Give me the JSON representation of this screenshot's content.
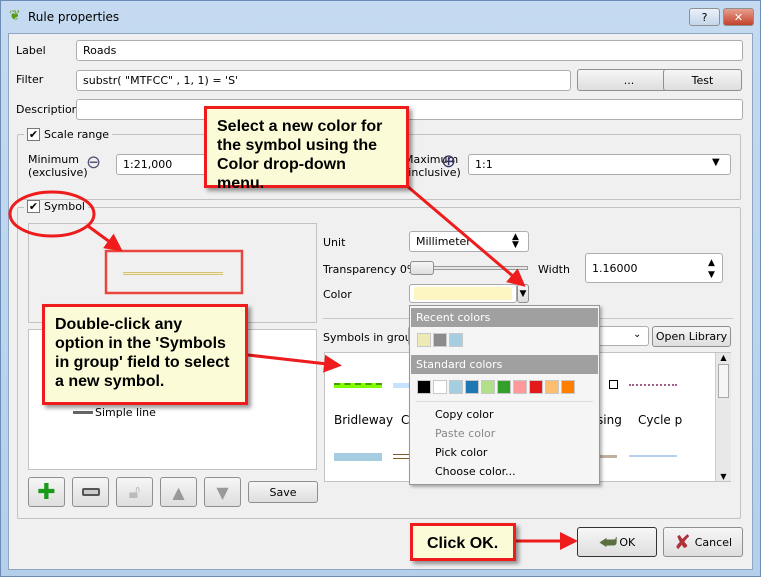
{
  "window": {
    "title": "Rule properties",
    "help": "?",
    "close": "✕"
  },
  "label": {
    "label": "Label",
    "value": "Roads"
  },
  "filter": {
    "label": "Filter",
    "value": "substr(  \"MTFCC\" , 1, 1) = 'S'",
    "ellipsis": "...",
    "test": "Test"
  },
  "description": {
    "label": "Description",
    "value": ""
  },
  "scale": {
    "title": "Scale range",
    "checked": true,
    "min_label1": "Minimum",
    "min_label2": "(exclusive)",
    "min_value": "1:21,000",
    "max_label1": "Maximum",
    "max_label2": "(inclusive)",
    "max_value": "1:1"
  },
  "symbol": {
    "title": "Symbol",
    "checked": true,
    "preview_color": "#f2e6a0",
    "tree_item": "Simple line",
    "save": "Save",
    "unit_label": "Unit",
    "unit_value": "Millimeter",
    "transparency_label": "Transparency 0%",
    "width_label": "Width",
    "width_value": "1.16000",
    "color_label": "Color",
    "color_value": "#fdf6c3",
    "symbols_in_group": "Symbols in group",
    "open_library": "Open Library",
    "symbols": [
      "Bridleway",
      "C",
      "sing",
      "Cycle p"
    ]
  },
  "color_menu": {
    "recent_header": "Recent colors",
    "recent": [
      "#eeeab5",
      "#8c8c8c",
      "#a6cee3"
    ],
    "standard_header": "Standard colors",
    "standard": [
      "#000000",
      "#ffffff",
      "#a6cee3",
      "#1f78b4",
      "#b2df8a",
      "#33a02c",
      "#fb9a99",
      "#e31a1c",
      "#fdbf6f",
      "#ff7f00"
    ],
    "items": [
      {
        "label": "Copy color",
        "enabled": true
      },
      {
        "label": "Paste color",
        "enabled": false
      },
      {
        "label": "Pick color",
        "enabled": true
      },
      {
        "label": "Choose color...",
        "enabled": true
      }
    ]
  },
  "buttons": {
    "ok": "OK",
    "cancel": "Cancel"
  },
  "callouts": {
    "color": "Select a new color for the symbol using the Color drop-down menu.",
    "symbols": "Double-click any option in the 'Symbols in group' field to select a new symbol.",
    "ok": "Click OK."
  },
  "colors": {
    "annotation": "#ee1c1c",
    "callout_bg": "#fbfcd7"
  }
}
